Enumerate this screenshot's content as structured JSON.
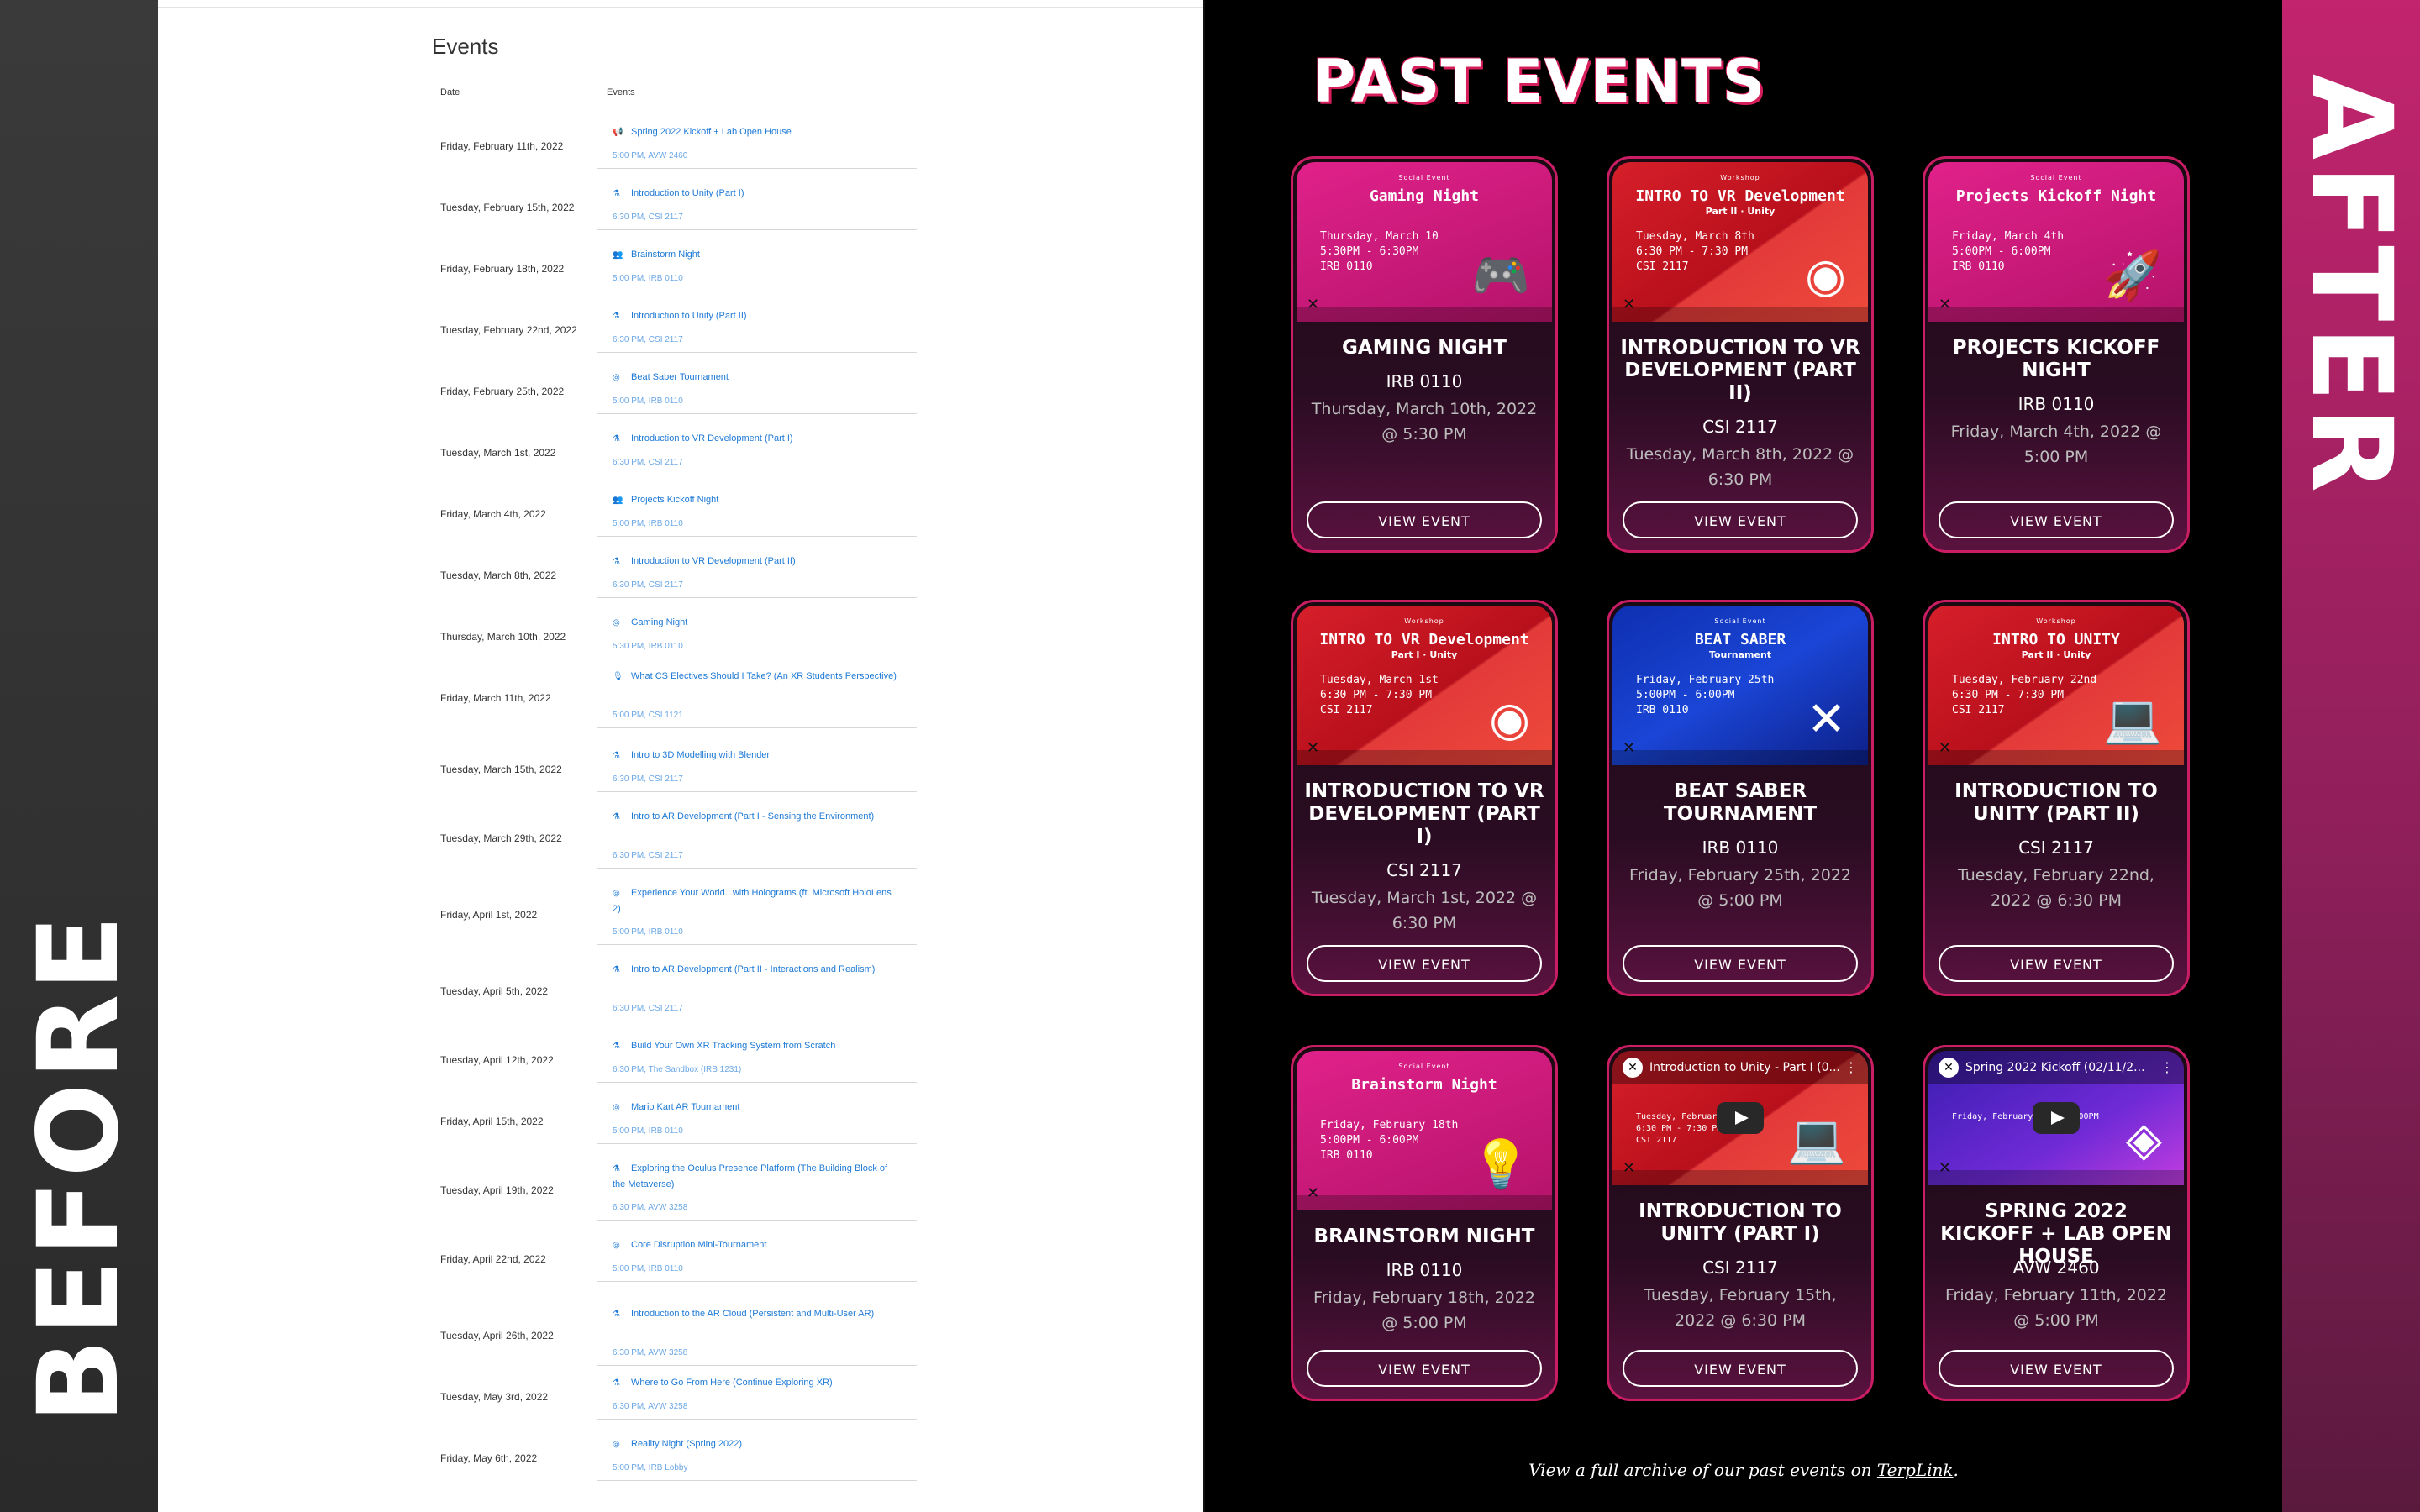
{
  "labels": {
    "before": "BEFORE",
    "after": "AFTER"
  },
  "before": {
    "title": "Events",
    "col_date": "Date",
    "col_events": "Events",
    "rows": [
      {
        "date": "Friday, February 11th, 2022",
        "name": "Spring 2022 Kickoff + Lab Open House",
        "loc": "5:00 PM, AVW 2460",
        "icon": "megaphone-icon"
      },
      {
        "date": "Tuesday, February 15th, 2022",
        "name": "Introduction to Unity (Part I)",
        "loc": "6:30 PM, CSI 2117",
        "icon": "flask-icon"
      },
      {
        "date": "Friday, February 18th, 2022",
        "name": "Brainstorm Night",
        "loc": "5:00 PM, IRB 0110",
        "icon": "people-icon"
      },
      {
        "date": "Tuesday, February 22nd, 2022",
        "name": "Introduction to Unity (Part II)",
        "loc": "6:30 PM, CSI 2117",
        "icon": "flask-icon"
      },
      {
        "date": "Friday, February 25th, 2022",
        "name": "Beat Saber Tournament",
        "loc": "5:00 PM, IRB 0110",
        "icon": "gamepad-icon"
      },
      {
        "date": "Tuesday, March 1st, 2022",
        "name": "Introduction to VR Development (Part I)",
        "loc": "6:30 PM, CSI 2117",
        "icon": "flask-icon"
      },
      {
        "date": "Friday, March 4th, 2022",
        "name": "Projects Kickoff Night",
        "loc": "5:00 PM, IRB 0110",
        "icon": "people-icon"
      },
      {
        "date": "Tuesday, March 8th, 2022",
        "name": "Introduction to VR Development (Part II)",
        "loc": "6:30 PM, CSI 2117",
        "icon": "flask-icon"
      },
      {
        "date": "Thursday, March 10th, 2022",
        "name": "Gaming Night",
        "loc": "5:30 PM, IRB 0110",
        "icon": "gamepad-icon"
      },
      {
        "date": "Friday, March 11th, 2022",
        "name": "What CS Electives Should I Take? (An XR Students Perspective)",
        "loc": "5:00 PM, CSI 1121",
        "icon": "mic-icon"
      },
      {
        "date": "Tuesday, March 15th, 2022",
        "name": "Intro to 3D Modelling with Blender",
        "loc": "6:30 PM, CSI 2117",
        "icon": "flask-icon"
      },
      {
        "date": "Tuesday, March 29th, 2022",
        "name": "Intro to AR Development (Part I - Sensing the Environment)",
        "loc": "6:30 PM, CSI 2117",
        "icon": "flask-icon"
      },
      {
        "date": "Friday, April 1st, 2022",
        "name": "Experience Your World...with Holograms (ft. Microsoft HoloLens 2)",
        "loc": "5:00 PM, IRB 0110",
        "icon": "gamepad-icon"
      },
      {
        "date": "Tuesday, April 5th, 2022",
        "name": "Intro to AR Development (Part II - Interactions and Realism)",
        "loc": "6:30 PM, CSI 2117",
        "icon": "flask-icon"
      },
      {
        "date": "Tuesday, April 12th, 2022",
        "name": "Build Your Own XR Tracking System from Scratch",
        "loc": "6:30 PM, The Sandbox (IRB 1231)",
        "icon": "flask-icon"
      },
      {
        "date": "Friday, April 15th, 2022",
        "name": "Mario Kart AR Tournament",
        "loc": "5:00 PM, IRB 0110",
        "icon": "gamepad-icon"
      },
      {
        "date": "Tuesday, April 19th, 2022",
        "name": "Exploring the Oculus Presence Platform (The Building Block of the Metaverse)",
        "loc": "6:30 PM, AVW 3258",
        "icon": "flask-icon"
      },
      {
        "date": "Friday, April 22nd, 2022",
        "name": "Core Disruption Mini-Tournament",
        "loc": "5:00 PM, IRB 0110",
        "icon": "gamepad-icon"
      },
      {
        "date": "Tuesday, April 26th, 2022",
        "name": "Introduction to the AR Cloud (Persistent and Multi-User AR)",
        "loc": "6:30 PM, AVW 3258",
        "icon": "flask-icon"
      },
      {
        "date": "Tuesday, May 3rd, 2022",
        "name": "Where to Go From Here (Continue Exploring XR)",
        "loc": "6:30 PM, AVW 3258",
        "icon": "flask-icon"
      },
      {
        "date": "Friday, May 6th, 2022",
        "name": "Reality Night (Spring 2022)",
        "loc": "5:00 PM, IRB Lobby",
        "icon": "gamepad-icon"
      }
    ]
  },
  "after": {
    "title": "PAST EVENTS",
    "button_label": "VIEW EVENT",
    "cards": [
      {
        "title": "GAMING NIGHT",
        "loc": "IRB 0110",
        "date": "Thursday, March 10th, 2022 @ 5:30 PM",
        "thumb": {
          "style": "pink",
          "kicker": "Social Event",
          "title": "Gaming Night",
          "sub": "",
          "info": "Thursday, March 10\n5:30PM - 6:30PM\nIRB 0110",
          "art": "gamepad-icon",
          "art_glyph": "🎮"
        }
      },
      {
        "title": "INTRODUCTION TO VR DEVELOPMENT (PART II)",
        "loc": "CSI 2117",
        "date": "Tuesday, March 8th, 2022 @ 6:30 PM",
        "thumb": {
          "style": "red",
          "kicker": "Workshop",
          "title": "INTRO TO VR Development",
          "sub": "Part II · Unity",
          "info": "Tuesday, March 8th\n6:30 PM - 7:30 PM\nCSI 2117",
          "art": "vr-headset-icon",
          "art_glyph": "◉"
        }
      },
      {
        "title": "PROJECTS KICKOFF NIGHT",
        "loc": "IRB 0110",
        "date": "Friday, March 4th, 2022 @ 5:00 PM",
        "thumb": {
          "style": "pink",
          "kicker": "Social Event",
          "title": "Projects Kickoff Night",
          "sub": "",
          "info": "Friday, March 4th\n5:00PM - 6:00PM\nIRB 0110",
          "art": "rocket-icon",
          "art_glyph": "🚀"
        }
      },
      {
        "title": "INTRODUCTION TO VR DEVELOPMENT (PART I)",
        "loc": "CSI 2117",
        "date": "Tuesday, March 1st, 2022 @ 6:30 PM",
        "thumb": {
          "style": "red",
          "kicker": "Workshop",
          "title": "INTRO TO VR Development",
          "sub": "Part I · Unity",
          "info": "Tuesday, March 1st\n6:30 PM - 7:30 PM\nCSI 2117",
          "art": "vr-headset-icon",
          "art_glyph": "◉"
        }
      },
      {
        "title": "BEAT SABER TOURNAMENT",
        "loc": "IRB 0110",
        "date": "Friday, February 25th, 2022 @ 5:00 PM",
        "thumb": {
          "style": "blue",
          "kicker": "Social Event",
          "title": "BEAT SABER",
          "sub": "Tournament",
          "info": "Friday, February 25th\n5:00PM - 6:00PM\nIRB 0110",
          "art": "sabers-icon",
          "art_glyph": "✕"
        }
      },
      {
        "title": "INTRODUCTION TO UNITY (PART II)",
        "loc": "CSI 2117",
        "date": "Tuesday, February 22nd, 2022 @ 6:30 PM",
        "thumb": {
          "style": "red",
          "kicker": "Workshop",
          "title": "INTRO TO UNITY",
          "sub": "Part II · Unity",
          "info": "Tuesday, February 22nd\n6:30 PM - 7:30 PM\nCSI 2117",
          "art": "laptop-icon",
          "art_glyph": "💻"
        }
      },
      {
        "title": "BRAINSTORM NIGHT",
        "loc": "IRB 0110",
        "date": "Friday, February 18th, 2022 @ 5:00 PM",
        "thumb": {
          "style": "pink",
          "kicker": "Social Event",
          "title": "Brainstorm Night",
          "sub": "",
          "info": "Friday, February 18th\n5:00PM - 6:00PM\nIRB 0110",
          "art": "lightbulb-icon",
          "art_glyph": "💡"
        }
      },
      {
        "title": "INTRODUCTION TO UNITY (PART I)",
        "loc": "CSI 2117",
        "date": "Tuesday, February 15th, 2022 @ 6:30 PM",
        "thumb": {
          "style": "red",
          "kicker": "",
          "title": "",
          "sub": "",
          "info": "Tuesday, February 15\n6:30 PM - 7:30 PM\nCSI 2117",
          "art": "laptop-icon",
          "art_glyph": "💻",
          "video_title": "Introduction to Unity - Part I (0..."
        }
      },
      {
        "title": "SPRING 2022 KICKOFF + LAB OPEN HOUSE",
        "loc": "AVW 2460",
        "date": "Friday, February 11th, 2022 @ 5:00 PM",
        "thumb": {
          "style": "purple",
          "kicker": "",
          "title": "",
          "sub": "",
          "info": "Friday, February 11 at 5:00PM",
          "art": "vr-headset-icon",
          "art_glyph": "◈",
          "video_title": "Spring 2022 Kickoff (02/11/2..."
        }
      }
    ],
    "footer_text": "View a full archive of our past events on ",
    "footer_link": "TerpLink",
    "footer_end": "."
  },
  "colors": {
    "accent": "#c91e63",
    "link": "#1e7ad6",
    "after_bg": "#000000"
  }
}
